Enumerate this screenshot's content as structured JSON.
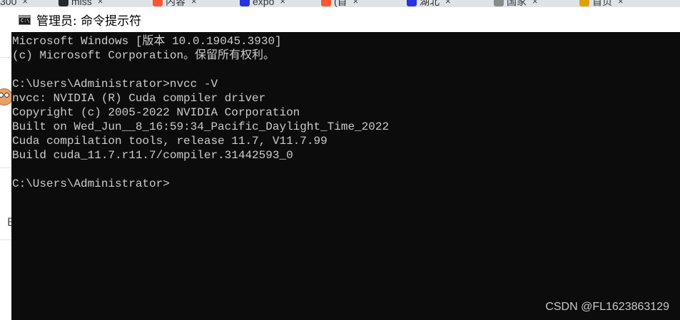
{
  "browser": {
    "tabs": [
      {
        "label": "300",
        "icon": "tab-page-icon",
        "color": "#9aa0a6"
      },
      {
        "label": "miss",
        "icon": "github-icon",
        "color": "#24292e"
      },
      {
        "label": "内容",
        "icon": "csdn-c-icon",
        "color": "#fc5531"
      },
      {
        "label": "expo",
        "icon": "baidu-paw-icon",
        "color": "#2932e1"
      },
      {
        "label": "(首",
        "icon": "csdn-c-icon",
        "color": "#fc5531"
      },
      {
        "label": "湖北",
        "icon": "baidu-paw-icon",
        "color": "#2932e1"
      },
      {
        "label": "国家",
        "icon": "globe-icon",
        "color": "#8a8a8a"
      },
      {
        "label": "首页",
        "icon": "crown-icon",
        "color": "#e0a100"
      }
    ],
    "close_glyph": "×",
    "sidebar_letter": "E"
  },
  "console": {
    "title": "管理员: 命令提示符",
    "icon_glyph": "C:\\",
    "lines": [
      "Microsoft Windows [版本 10.0.19045.3930]",
      "(c) Microsoft Corporation。保留所有权利。",
      "",
      "C:\\Users\\Administrator>nvcc -V",
      "nvcc: NVIDIA (R) Cuda compiler driver",
      "Copyright (c) 2005-2022 NVIDIA Corporation",
      "Built on Wed_Jun__8_16:59:34_Pacific_Daylight_Time_2022",
      "Cuda compilation tools, release 11.7, V11.7.99",
      "Build cuda_11.7.r11.7/compiler.31442593_0",
      "",
      "C:\\Users\\Administrator>"
    ],
    "colors": {
      "background": "#0c0c0c",
      "text": "#cccccc",
      "title_bar": "#ffffff"
    }
  },
  "watermark": "CSDN @FL1623863129"
}
